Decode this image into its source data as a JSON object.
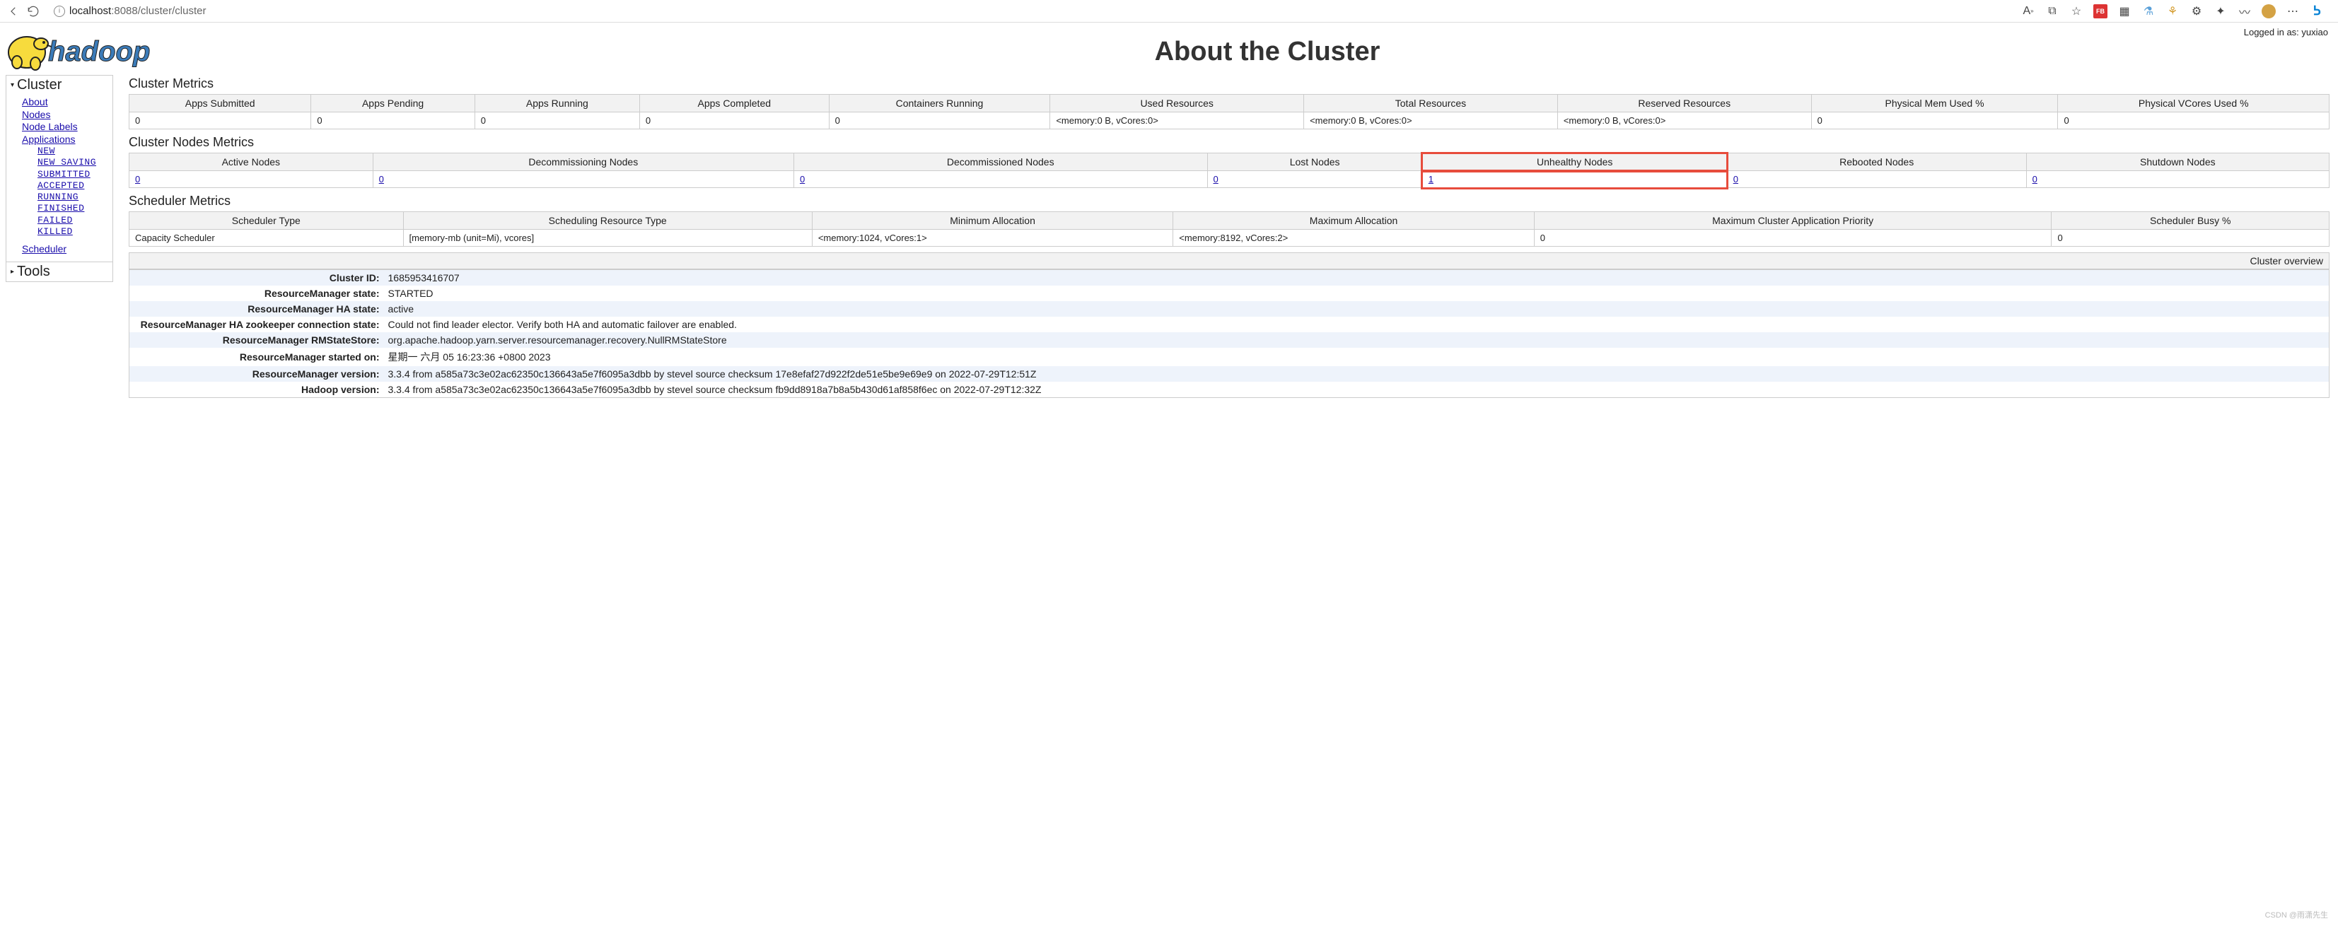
{
  "browser": {
    "url_hostname": "localhost",
    "url_port": ":8088",
    "url_path": "/cluster/cluster",
    "icons": [
      "read-aloud",
      "library",
      "favorite",
      "fb-ext",
      "qr-ext",
      "beaker-ext",
      "tree-ext",
      "ext-menu",
      "collections",
      "ruler-ext",
      "cookie",
      "more",
      "bing"
    ]
  },
  "login": {
    "text": "Logged in as: yuxiao"
  },
  "page_title": "About the Cluster",
  "sidebar": {
    "cluster_label": "Cluster",
    "tools_label": "Tools",
    "links": {
      "about": "About",
      "nodes": "Nodes",
      "node_labels": "Node Labels",
      "applications": "Applications",
      "scheduler": "Scheduler"
    },
    "app_states": [
      "NEW",
      "NEW_SAVING",
      "SUBMITTED",
      "ACCEPTED",
      "RUNNING",
      "FINISHED",
      "FAILED",
      "KILLED"
    ]
  },
  "cluster_metrics": {
    "title": "Cluster Metrics",
    "headers": [
      "Apps Submitted",
      "Apps Pending",
      "Apps Running",
      "Apps Completed",
      "Containers Running",
      "Used Resources",
      "Total Resources",
      "Reserved Resources",
      "Physical Mem Used %",
      "Physical VCores Used %"
    ],
    "row": [
      "0",
      "0",
      "0",
      "0",
      "0",
      "<memory:0 B, vCores:0>",
      "<memory:0 B, vCores:0>",
      "<memory:0 B, vCores:0>",
      "0",
      "0"
    ]
  },
  "node_metrics": {
    "title": "Cluster Nodes Metrics",
    "headers": [
      "Active Nodes",
      "Decommissioning Nodes",
      "Decommissioned Nodes",
      "Lost Nodes",
      "Unhealthy Nodes",
      "Rebooted Nodes",
      "Shutdown Nodes"
    ],
    "row": [
      "0",
      "0",
      "0",
      "0",
      "1",
      "0",
      "0"
    ],
    "highlight_index": 4
  },
  "scheduler_metrics": {
    "title": "Scheduler Metrics",
    "headers": [
      "Scheduler Type",
      "Scheduling Resource Type",
      "Minimum Allocation",
      "Maximum Allocation",
      "Maximum Cluster Application Priority",
      "Scheduler Busy %"
    ],
    "row": [
      "Capacity Scheduler",
      "[memory-mb (unit=Mi), vcores]",
      "<memory:1024, vCores:1>",
      "<memory:8192, vCores:2>",
      "0",
      "0"
    ]
  },
  "overview": {
    "title": "Cluster overview",
    "rows": [
      {
        "k": "Cluster ID:",
        "v": "1685953416707"
      },
      {
        "k": "ResourceManager state:",
        "v": "STARTED"
      },
      {
        "k": "ResourceManager HA state:",
        "v": "active"
      },
      {
        "k": "ResourceManager HA zookeeper connection state:",
        "v": "Could not find leader elector. Verify both HA and automatic failover are enabled."
      },
      {
        "k": "ResourceManager RMStateStore:",
        "v": "org.apache.hadoop.yarn.server.resourcemanager.recovery.NullRMStateStore"
      },
      {
        "k": "ResourceManager started on:",
        "v": "星期一 六月 05 16:23:36 +0800 2023"
      },
      {
        "k": "ResourceManager version:",
        "v": "3.3.4 from a585a73c3e02ac62350c136643a5e7f6095a3dbb by stevel source checksum 17e8efaf27d922f2de51e5be9e69e9 on 2022-07-29T12:51Z"
      },
      {
        "k": "Hadoop version:",
        "v": "3.3.4 from a585a73c3e02ac62350c136643a5e7f6095a3dbb by stevel source checksum fb9dd8918a7b8a5b430d61af858f6ec on 2022-07-29T12:32Z"
      }
    ]
  },
  "watermark": "CSDN @雨潇先生"
}
